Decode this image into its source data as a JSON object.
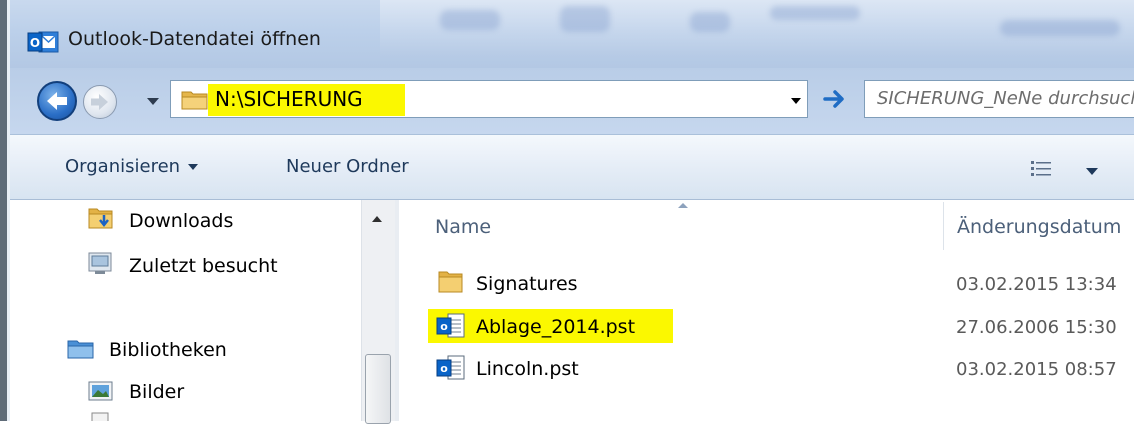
{
  "window": {
    "title": "Outlook-Datendatei öffnen",
    "app_icon": "outlook-icon"
  },
  "navigation": {
    "back_icon": "back-arrow-icon",
    "forward_icon": "forward-arrow-icon",
    "history_icon": "chevron-down-icon"
  },
  "address_bar": {
    "path": "N:\\SICHERUNG",
    "folder_icon": "folder-icon",
    "highlight_color": "#fbf800"
  },
  "search": {
    "placeholder": "SICHERUNG_NeNe durchsuchen"
  },
  "toolbar": {
    "organize_label": "Organisieren",
    "new_folder_label": "Neuer Ordner",
    "view_icon": "view-details-icon"
  },
  "nav_pane": {
    "items": [
      {
        "label": "Downloads",
        "icon": "downloads-folder-icon"
      },
      {
        "label": "Zuletzt besucht",
        "icon": "recent-places-icon"
      },
      {
        "label": "Bibliotheken",
        "icon": "libraries-icon"
      },
      {
        "label": "Bilder",
        "icon": "pictures-icon"
      }
    ]
  },
  "file_list": {
    "columns": [
      "Name",
      "Änderungsdatum"
    ],
    "sorted_column": "Name",
    "rows": [
      {
        "name": "Signatures",
        "modified": "03.02.2015 13:34",
        "icon": "folder-icon",
        "highlighted": false
      },
      {
        "name": "Ablage_2014.pst",
        "modified": "27.06.2006 15:30",
        "icon": "outlook-data-file-icon",
        "highlighted": true
      },
      {
        "name": "Lincoln.pst",
        "modified": "03.02.2015 08:57",
        "icon": "outlook-data-file-icon",
        "highlighted": false
      }
    ]
  },
  "colors": {
    "highlight": "#fbf800",
    "accent": "#2a6ec6",
    "toolbar_text": "#1e395b"
  }
}
